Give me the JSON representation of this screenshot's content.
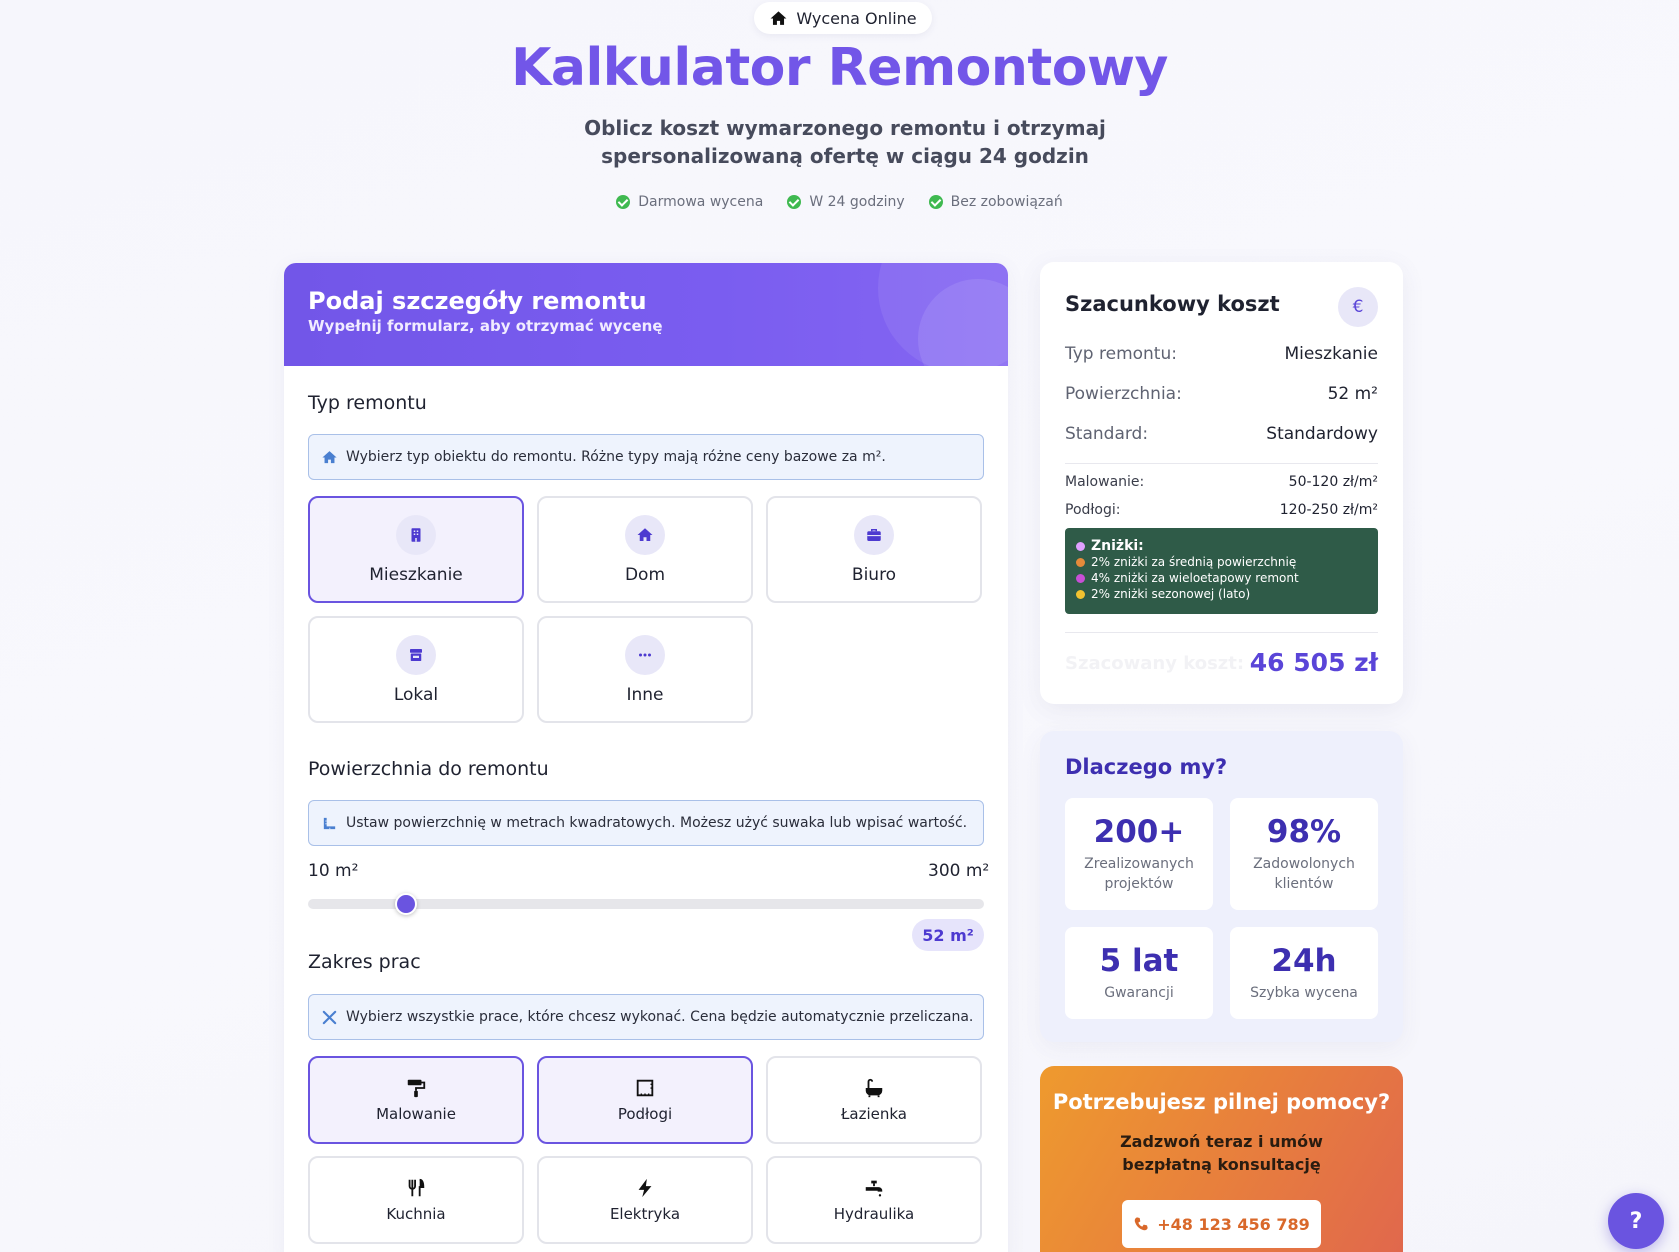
{
  "hero": {
    "badge": "Wycena Online",
    "title": "Kalkulator Remontowy",
    "subtitle": "Oblicz koszt wymarzonego remontu i otrzymaj spersonalizowaną ofertę w ciągu 24 godzin",
    "features": [
      "Darmowa wycena",
      "W 24 godziny",
      "Bez zobowiązań"
    ]
  },
  "form": {
    "header_title": "Podaj szczegóły remontu",
    "header_sub": "Wypełnij formularz, aby otrzymać wycenę",
    "type_section": {
      "title": "Typ remontu",
      "info": "Wybierz typ obiektu do remontu. Różne typy mają różne ceny bazowe za m².",
      "options": [
        {
          "label": "Mieszkanie",
          "icon": "building-icon",
          "selected": true
        },
        {
          "label": "Dom",
          "icon": "house-icon",
          "selected": false
        },
        {
          "label": "Biuro",
          "icon": "briefcase-icon",
          "selected": false
        },
        {
          "label": "Lokal",
          "icon": "store-icon",
          "selected": false
        },
        {
          "label": "Inne",
          "icon": "ellipsis-icon",
          "selected": false
        }
      ]
    },
    "area_section": {
      "title": "Powierzchnia do remontu",
      "info": "Ustaw powierzchnię w metrach kwadratowych. Możesz użyć suwaka lub wpisać wartość.",
      "min_label": "10 m²",
      "max_label": "300 m²",
      "min": 10,
      "max": 300,
      "value": 52,
      "value_label": "52 m²"
    },
    "scope_section": {
      "title": "Zakres prac",
      "info": "Wybierz wszystkie prace, które chcesz wykonać. Cena będzie automatycznie przeliczana.",
      "options": [
        {
          "label": "Malowanie",
          "icon": "paint-roller-icon",
          "selected": true
        },
        {
          "label": "Podłogi",
          "icon": "floor-icon",
          "selected": true
        },
        {
          "label": "Łazienka",
          "icon": "bath-icon",
          "selected": false
        },
        {
          "label": "Kuchnia",
          "icon": "utensils-icon",
          "selected": false
        },
        {
          "label": "Elektryka",
          "icon": "bolt-icon",
          "selected": false
        },
        {
          "label": "Hydraulika",
          "icon": "faucet-icon",
          "selected": false
        }
      ]
    }
  },
  "summary": {
    "title": "Szacunkowy koszt",
    "currency_symbol": "€",
    "rows": [
      {
        "key": "Typ remontu:",
        "value": "Mieszkanie"
      },
      {
        "key": "Powierzchnia:",
        "value": "52 m²"
      },
      {
        "key": "Standard:",
        "value": "Standardowy"
      }
    ],
    "prices": [
      {
        "key": "Malowanie:",
        "value": "50-120 zł/m²"
      },
      {
        "key": "Podłogi:",
        "value": "120-250 zł/m²"
      }
    ],
    "discounts": {
      "title": "Zniżki:",
      "items": [
        "2% zniżki za średnią powierzchnię",
        "4% zniżki za wieloetapowy remont",
        "2% zniżki sezonowej (lato)"
      ]
    },
    "estimate_label": "Szacowany koszt:",
    "estimate_value": "46 505 zł"
  },
  "why": {
    "title": "Dlaczego my?",
    "stats": [
      {
        "number": "200+",
        "text": "Zrealizowanych projektów"
      },
      {
        "number": "98%",
        "text": "Zadowolonych klientów"
      },
      {
        "number": "5 lat",
        "text": "Gwarancji"
      },
      {
        "number": "24h",
        "text": "Szybka wycena"
      }
    ]
  },
  "help": {
    "title": "Potrzebujesz pilnej pomocy?",
    "subtitle": "Zadzwoń teraz i umów bezpłatną konsultację",
    "phone": "+48 123 456 789"
  },
  "fab_label": "?",
  "colors": {
    "accent": "#6a54e0",
    "title": "#7256e8",
    "discount_bg": "#2f5b48",
    "help_gradient_start": "#ee9a2e",
    "help_gradient_end": "#e0674d"
  }
}
